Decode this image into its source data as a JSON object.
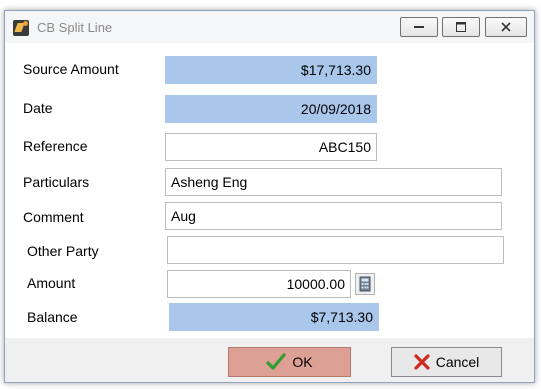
{
  "window": {
    "title": "CB Split Line",
    "icon": "app-icon"
  },
  "form": {
    "source_amount": {
      "label": "Source Amount",
      "value": "$17,713.30"
    },
    "date": {
      "label": "Date",
      "value": "20/09/2018"
    },
    "reference": {
      "label": "Reference",
      "value": "ABC150"
    },
    "particulars": {
      "label": "Particulars",
      "value": "Asheng Eng"
    },
    "comment": {
      "label": "Comment",
      "value": "Aug"
    },
    "other_party": {
      "label": "Other Party",
      "value": ""
    },
    "amount": {
      "label": "Amount",
      "value": "10000.00"
    },
    "balance": {
      "label": "Balance",
      "value": "$7,713.30"
    }
  },
  "buttons": {
    "ok_label": "OK",
    "cancel_label": "Cancel"
  },
  "colors": {
    "readonly_field": "#a8c7ea",
    "ok_button": "#dca094",
    "ok_check": "#2e9e2e",
    "cancel_x": "#d0281e"
  }
}
